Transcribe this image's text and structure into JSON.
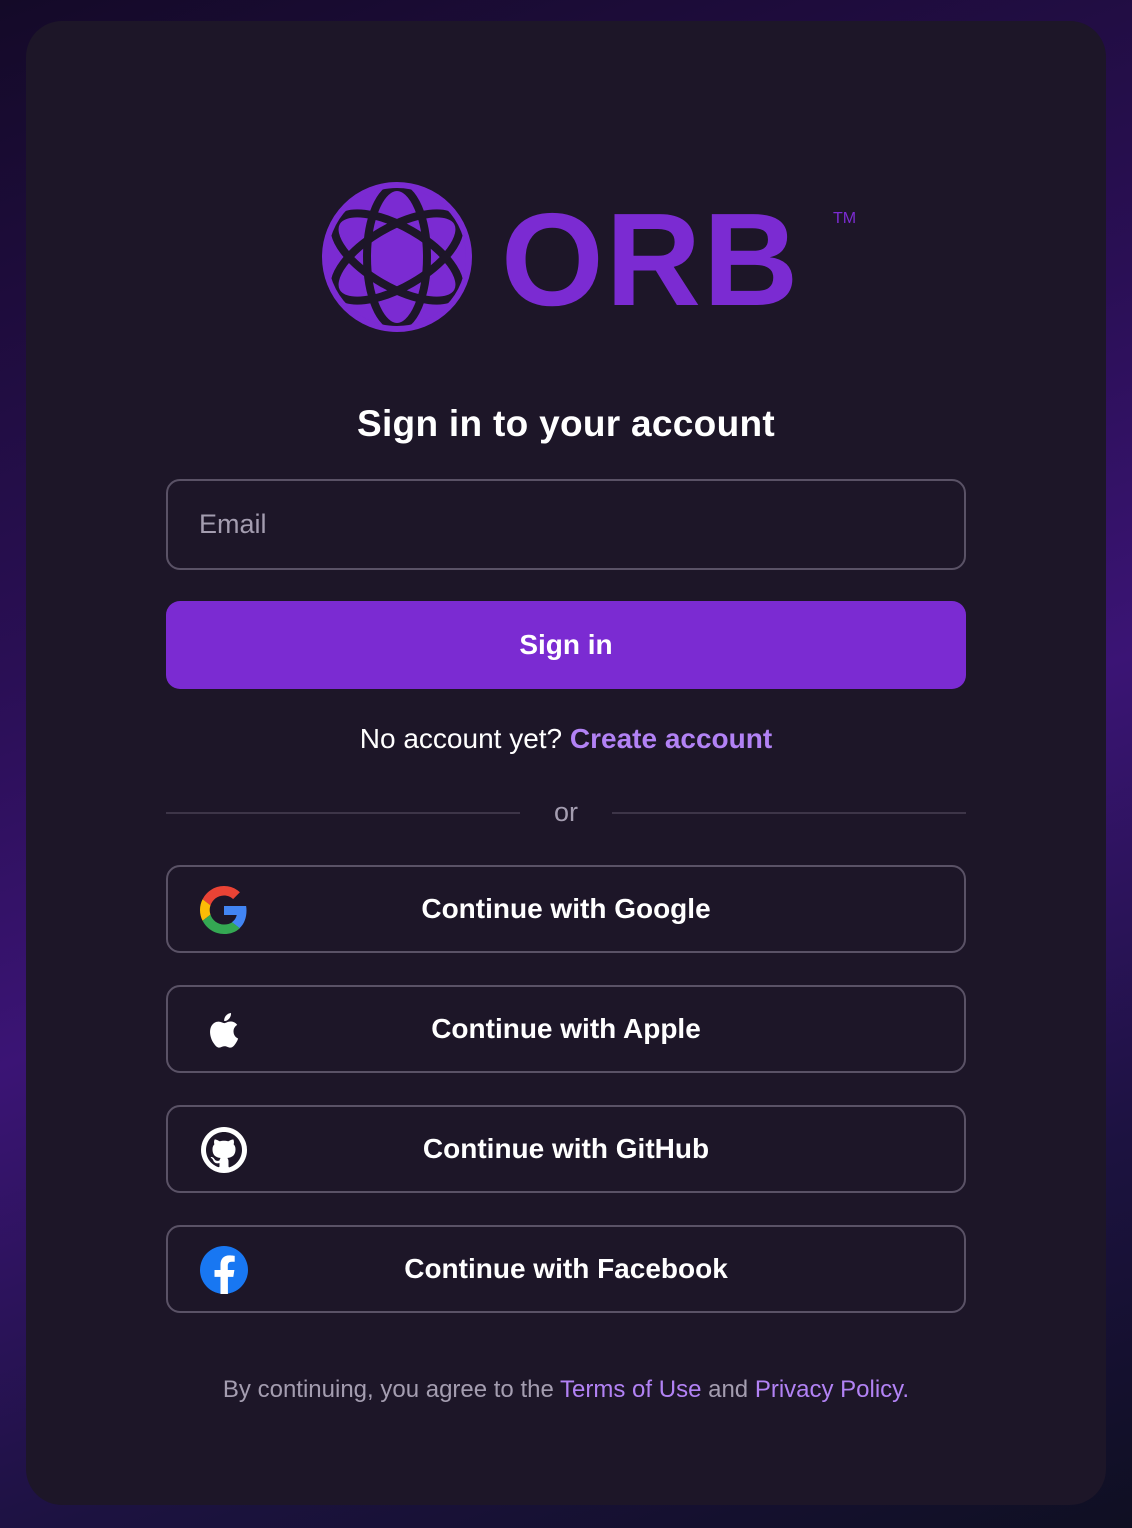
{
  "brand": {
    "name": "ORB",
    "trademark": "TM",
    "color": "#7b2bd2"
  },
  "heading": "Sign in to your account",
  "email": {
    "placeholder": "Email",
    "value": ""
  },
  "signin_button": "Sign in",
  "signup": {
    "prompt": "No account yet?",
    "link": "Create account"
  },
  "divider": "or",
  "social": [
    {
      "label": "Continue with Google",
      "icon": "google-icon"
    },
    {
      "label": "Continue with Apple",
      "icon": "apple-icon"
    },
    {
      "label": "Continue with GitHub",
      "icon": "github-icon"
    },
    {
      "label": "Continue with Facebook",
      "icon": "facebook-icon"
    }
  ],
  "legal": {
    "prefix": "By continuing, you agree to the",
    "terms": "Terms of Use",
    "and": "and",
    "privacy": "Privacy Policy",
    "suffix": "."
  },
  "colors": {
    "accent": "#7b2bd2",
    "link": "#b282f5",
    "card": "#1d1628"
  }
}
